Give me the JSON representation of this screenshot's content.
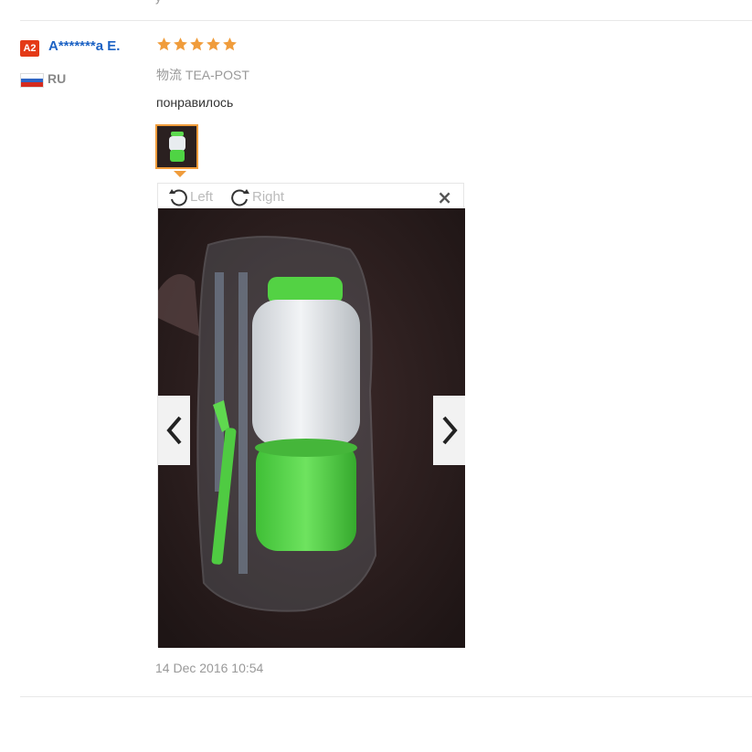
{
  "review": {
    "level_badge": "A2",
    "user_name": "A*******a E.",
    "country_code": "RU",
    "rating": 5,
    "shipping_label": "物流",
    "shipping_method": "TEA-POST",
    "comment": "понравилось",
    "timestamp": "14 Dec 2016 10:54"
  },
  "viewer": {
    "rotate_left_label": "Left",
    "rotate_right_label": "Right",
    "close_label": "×"
  },
  "colors": {
    "accent_orange": "#f09c3b",
    "username_blue": "#1c62c4",
    "badge_red": "#e43a17"
  }
}
